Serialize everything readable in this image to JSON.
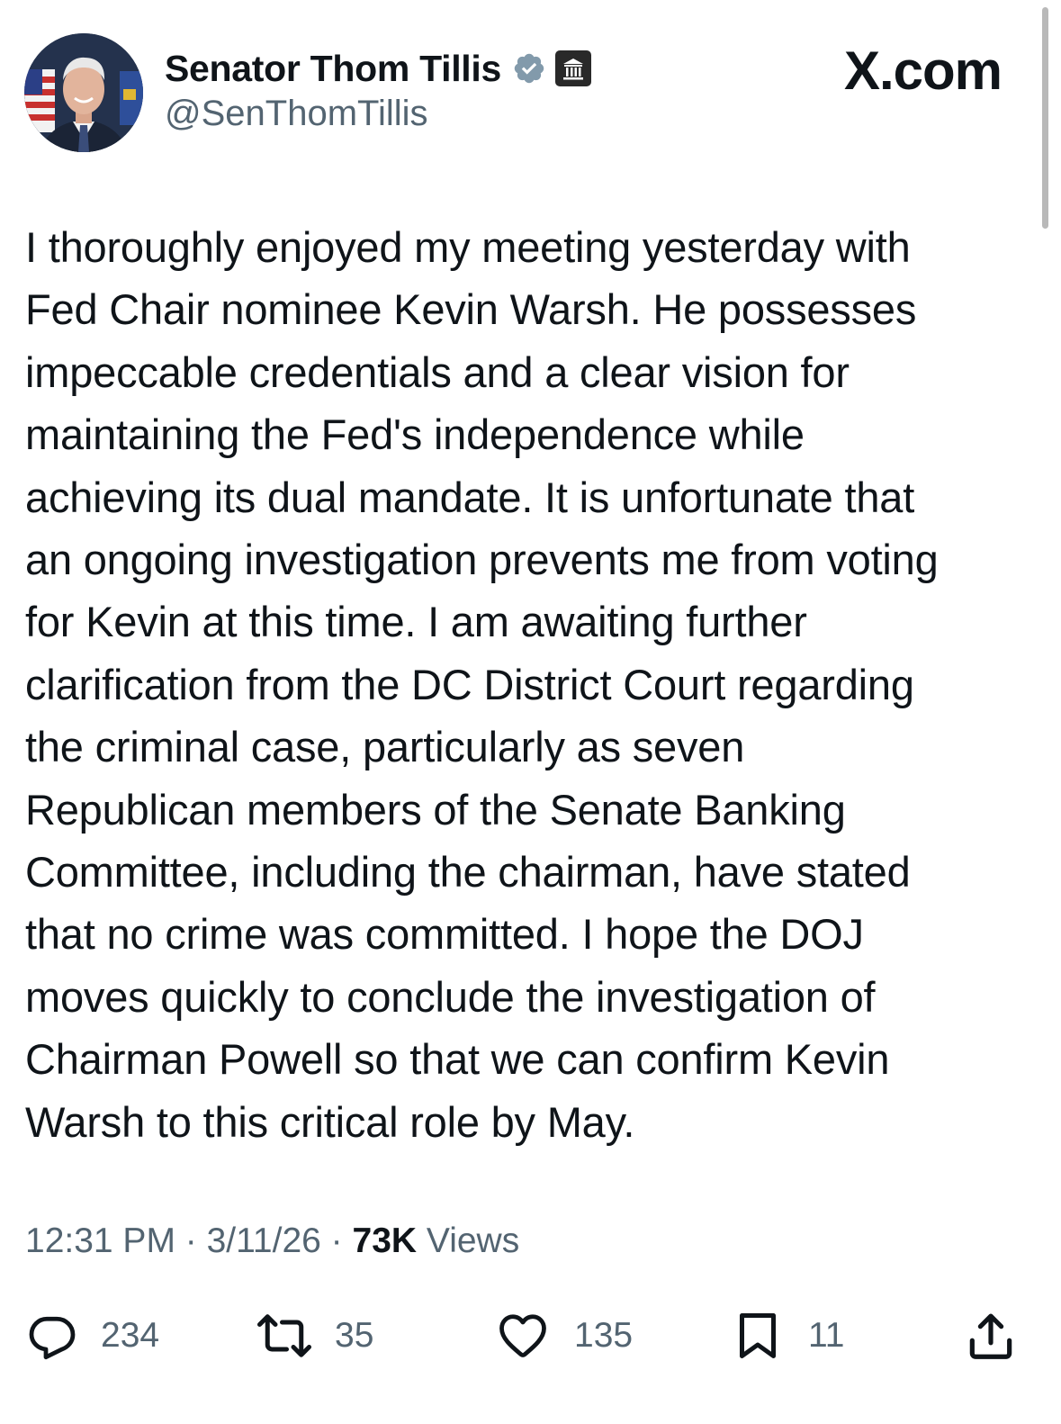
{
  "author": {
    "display_name": "Senator Thom Tillis",
    "handle": "@SenThomTillis",
    "verified_badge": "verified-badge-icon",
    "affiliation_badge": "government-building-icon"
  },
  "brand": {
    "label": "X.com"
  },
  "tweet": {
    "text": "I thoroughly enjoyed my meeting yesterday with\nFed Chair nominee Kevin Warsh. He possesses\nimpeccable credentials and a clear vision for\nmaintaining the Fed's independence while\nachieving its dual mandate. It is unfortunate that\nan ongoing investigation prevents me from voting\nfor Kevin at this time. I am awaiting further\nclarification from the DC District Court regarding\nthe criminal case, particularly as seven\nRepublican members of the Senate Banking\nCommittee, including the chairman, have stated\nthat no crime was committed. I hope the DOJ\nmoves quickly to conclude the investigation of\nChairman Powell so that we can confirm Kevin\nWarsh to this critical role by May."
  },
  "meta": {
    "time": "12:31 PM",
    "separator": " · ",
    "date": "3/11/26",
    "views_count": "73K",
    "views_label": " Views"
  },
  "actions": {
    "replies": "234",
    "reposts": "35",
    "likes": "135",
    "bookmarks": "11"
  },
  "colors": {
    "text": "#0f1419",
    "secondary": "#536471",
    "verified": "#829aab"
  }
}
